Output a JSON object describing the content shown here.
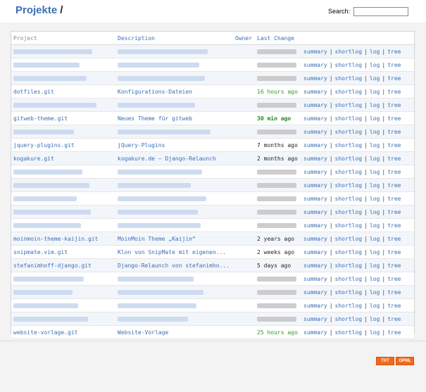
{
  "header": {
    "breadcrumb_label": "Projekte",
    "breadcrumb_separator": "/",
    "search_label": "Search:",
    "search_value": ""
  },
  "table": {
    "headers": {
      "project": "Project",
      "description": "Description",
      "owner": "Owner",
      "last_change": "Last Change"
    },
    "link_labels": [
      "summary",
      "shortlog",
      "log",
      "tree"
    ],
    "rows": [
      {
        "project": null,
        "description": null,
        "age": null
      },
      {
        "project": null,
        "description": null,
        "age": null
      },
      {
        "project": null,
        "description": null,
        "age": null
      },
      {
        "project": "dotfiles.git",
        "description": "Konfigurations-Dateien",
        "age": "16 hours ago",
        "age_style": "fresh"
      },
      {
        "project": null,
        "description": null,
        "age": null
      },
      {
        "project": "gitweb-theme.git",
        "description": "Neues Theme für gitweb",
        "age": "30 min ago",
        "age_style": "bold"
      },
      {
        "project": null,
        "description": null,
        "age": null
      },
      {
        "project": "jquery-plugins.git",
        "description": "jQuery-Plugins",
        "age": "7 months ago",
        "age_style": "normal"
      },
      {
        "project": "kogakure.git",
        "description": "kogakure.de – Django-Relaunch",
        "age": "2 months ago",
        "age_style": "normal"
      },
      {
        "project": null,
        "description": null,
        "age": null
      },
      {
        "project": null,
        "description": null,
        "age": null
      },
      {
        "project": null,
        "description": null,
        "age": null
      },
      {
        "project": null,
        "description": null,
        "age": null
      },
      {
        "project": null,
        "description": null,
        "age": null
      },
      {
        "project": "moinmoin-theme-kaijin.git",
        "description": "MoinMoin Theme „Kaijin“",
        "age": "2 years ago",
        "age_style": "normal"
      },
      {
        "project": "snipmate.vim.git",
        "description": "Klon von SnipMate mit eigenen...",
        "age": "2 weeks ago",
        "age_style": "normal"
      },
      {
        "project": "stefanimhoff-django.git",
        "description": "Django-Relaunch von stefanimho...",
        "age": "5 days ago",
        "age_style": "normal"
      },
      {
        "project": null,
        "description": null,
        "age": null
      },
      {
        "project": null,
        "description": null,
        "age": null
      },
      {
        "project": null,
        "description": null,
        "age": null
      },
      {
        "project": null,
        "description": null,
        "age": null
      },
      {
        "project": "website-vorlage.git",
        "description": "Website-Vorlage",
        "age": "25 hours ago",
        "age_style": "fresh"
      }
    ]
  },
  "footer": {
    "txt_label": "TXT",
    "opml_label": "OPML"
  },
  "colors": {
    "link_blue": "#3a6fb3",
    "fresh_green": "#2c9a2c",
    "feed_orange": "#ef6a1d",
    "row_stripe": "#f2f6fb"
  }
}
